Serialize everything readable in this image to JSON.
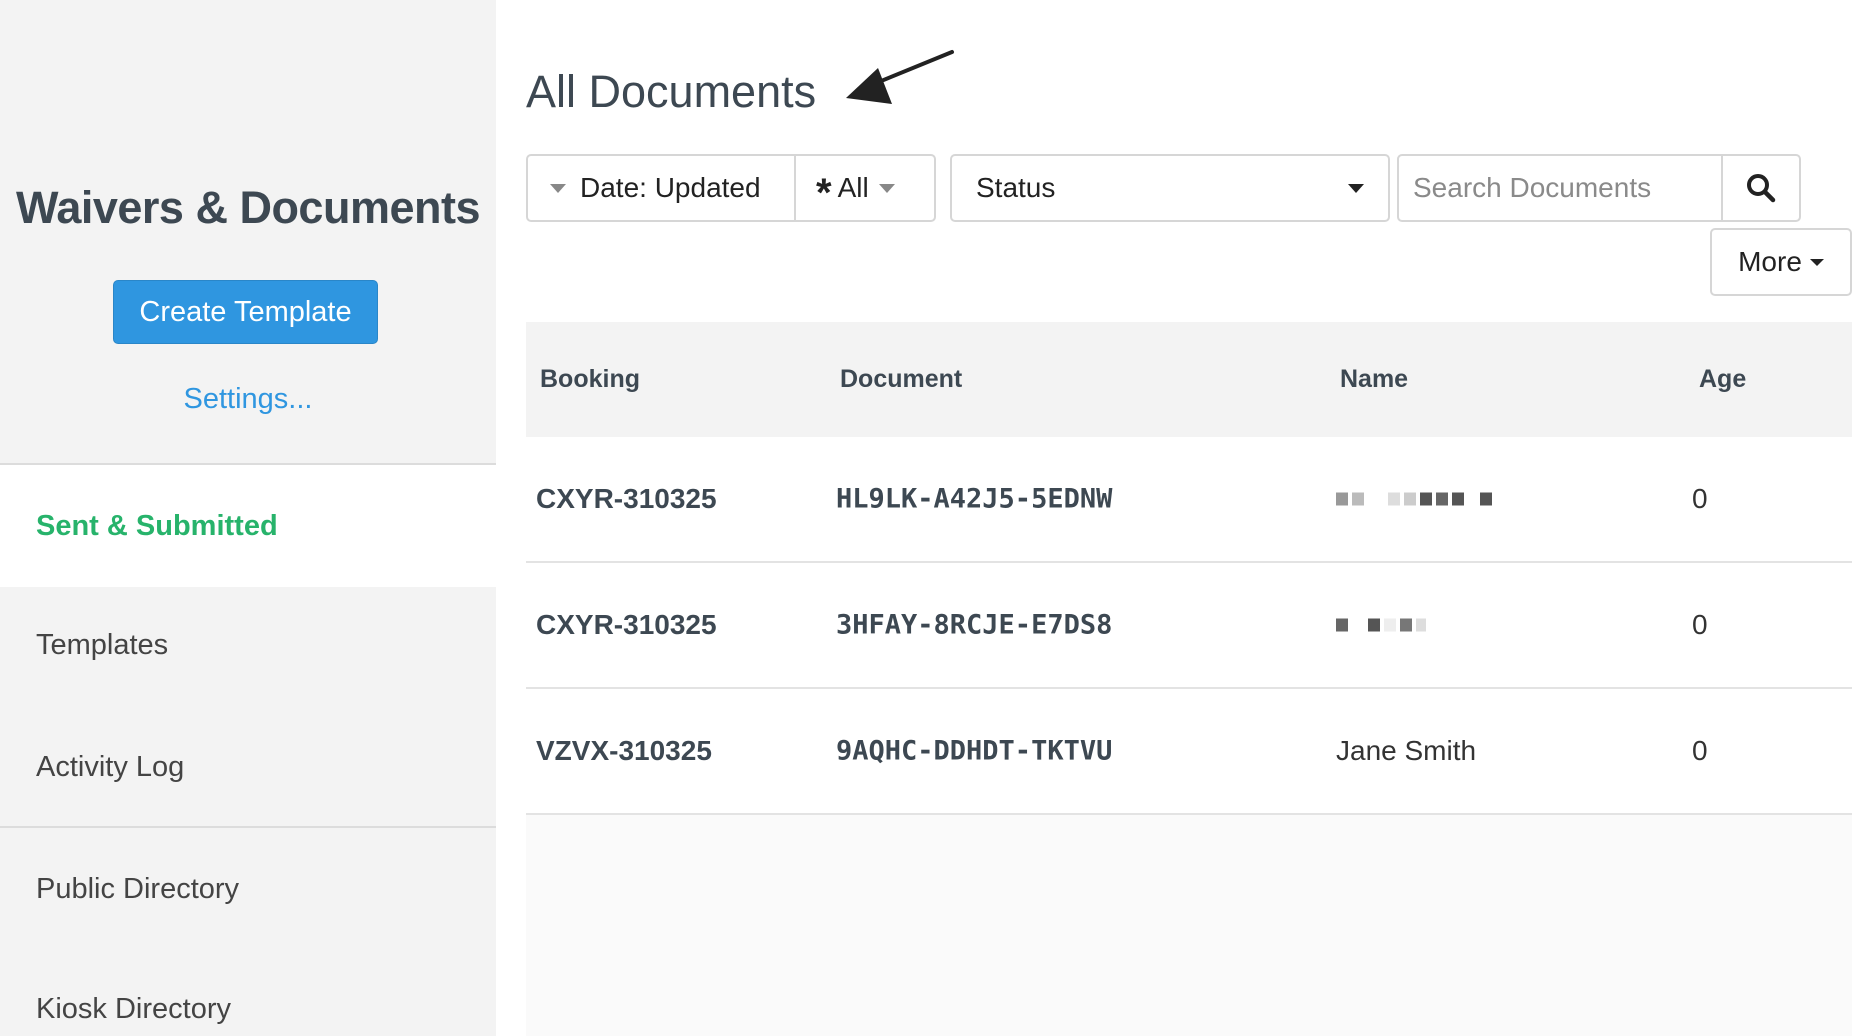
{
  "sidebar": {
    "title": "Waivers & Documents",
    "create_button": "Create Template",
    "settings_link": "Settings...",
    "nav": [
      {
        "label": "Sent & Submitted",
        "active": true
      },
      {
        "label": "Templates",
        "active": false
      },
      {
        "label": "Activity Log",
        "active": false
      },
      {
        "label": "Public Directory",
        "active": false
      },
      {
        "label": "Kiosk Directory",
        "active": false
      }
    ]
  },
  "main": {
    "title": "All Documents",
    "filters": {
      "date_label": "Date: Updated",
      "type_label": "All",
      "status_label": "Status",
      "search_placeholder": "Search Documents",
      "more_label": "More"
    },
    "table": {
      "headers": {
        "booking": "Booking",
        "document": "Document",
        "name": "Name",
        "age": "Age"
      },
      "rows": [
        {
          "booking": "CXYR-310325",
          "document": "HL9LK-A42J5-5EDNW",
          "name": "",
          "name_redacted": true,
          "age": "0"
        },
        {
          "booking": "CXYR-310325",
          "document": "3HFAY-8RCJE-E7DS8",
          "name": "",
          "name_redacted": true,
          "age": "0"
        },
        {
          "booking": "VZVX-310325",
          "document": "9AQHC-DDHDT-TKTVU",
          "name": "Jane Smith",
          "name_redacted": false,
          "age": "0"
        }
      ]
    }
  },
  "colors": {
    "accent": "#2f96e0",
    "active_nav": "#27b36b",
    "heading": "#3d4852",
    "sidebar_bg": "#f3f3f3"
  },
  "icons": {
    "search": "search-icon",
    "arrow": "arrow-annotation-icon",
    "asterisk": "asterisk-icon",
    "caret": "caret-down-icon"
  }
}
